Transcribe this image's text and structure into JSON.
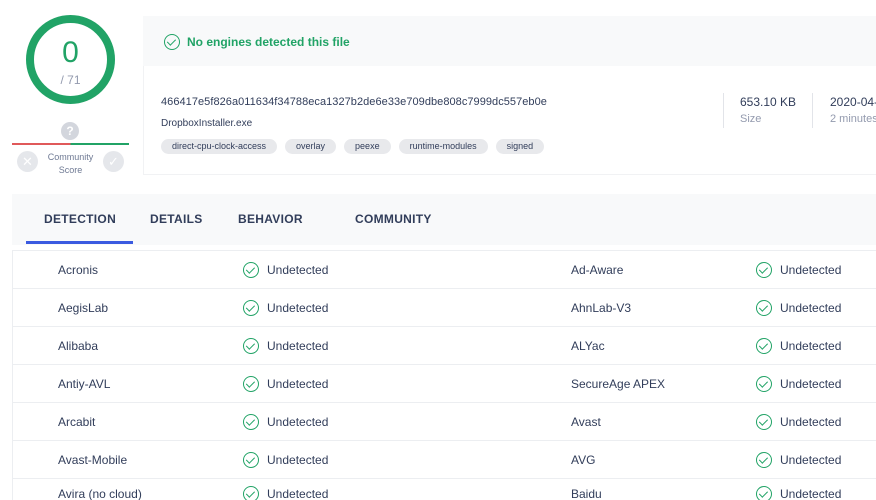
{
  "score": {
    "detections": "0",
    "total": "/ 71",
    "community_label_line1": "Community",
    "community_label_line2": "Score",
    "unknown_icon": "?",
    "bad_vote_icon": "✕",
    "good_vote_icon": "✓"
  },
  "summary": {
    "status_text": "No engines detected this file",
    "status_color": "#21a366"
  },
  "file": {
    "hash": "466417e5f826a011634f34788eca1327b2de6e33e709dbe808c7999dc557eb0e",
    "name": "DropboxInstaller.exe",
    "tags": [
      "direct-cpu-clock-access",
      "overlay",
      "peexe",
      "runtime-modules",
      "signed"
    ],
    "size_value": "653.10 KB",
    "size_label": "Size",
    "date_value": "2020-04-",
    "date_label": "2 minutes"
  },
  "tabs": {
    "detection": "DETECTION",
    "details": "DETAILS",
    "behavior": "BEHAVIOR",
    "community": "COMMUNITY",
    "active_color": "#3a5ae0"
  },
  "results": [
    {
      "left_engine": "Acronis",
      "left_result": "Undetected",
      "right_engine": "Ad-Aware",
      "right_result": "Undetected"
    },
    {
      "left_engine": "AegisLab",
      "left_result": "Undetected",
      "right_engine": "AhnLab-V3",
      "right_result": "Undetected"
    },
    {
      "left_engine": "Alibaba",
      "left_result": "Undetected",
      "right_engine": "ALYac",
      "right_result": "Undetected"
    },
    {
      "left_engine": "Antiy-AVL",
      "left_result": "Undetected",
      "right_engine": "SecureAge APEX",
      "right_result": "Undetected"
    },
    {
      "left_engine": "Arcabit",
      "left_result": "Undetected",
      "right_engine": "Avast",
      "right_result": "Undetected"
    },
    {
      "left_engine": "Avast-Mobile",
      "left_result": "Undetected",
      "right_engine": "AVG",
      "right_result": "Undetected"
    },
    {
      "left_engine": "Avira (no cloud)",
      "left_result": "Undetected",
      "right_engine": "Baidu",
      "right_result": "Undetected"
    }
  ]
}
